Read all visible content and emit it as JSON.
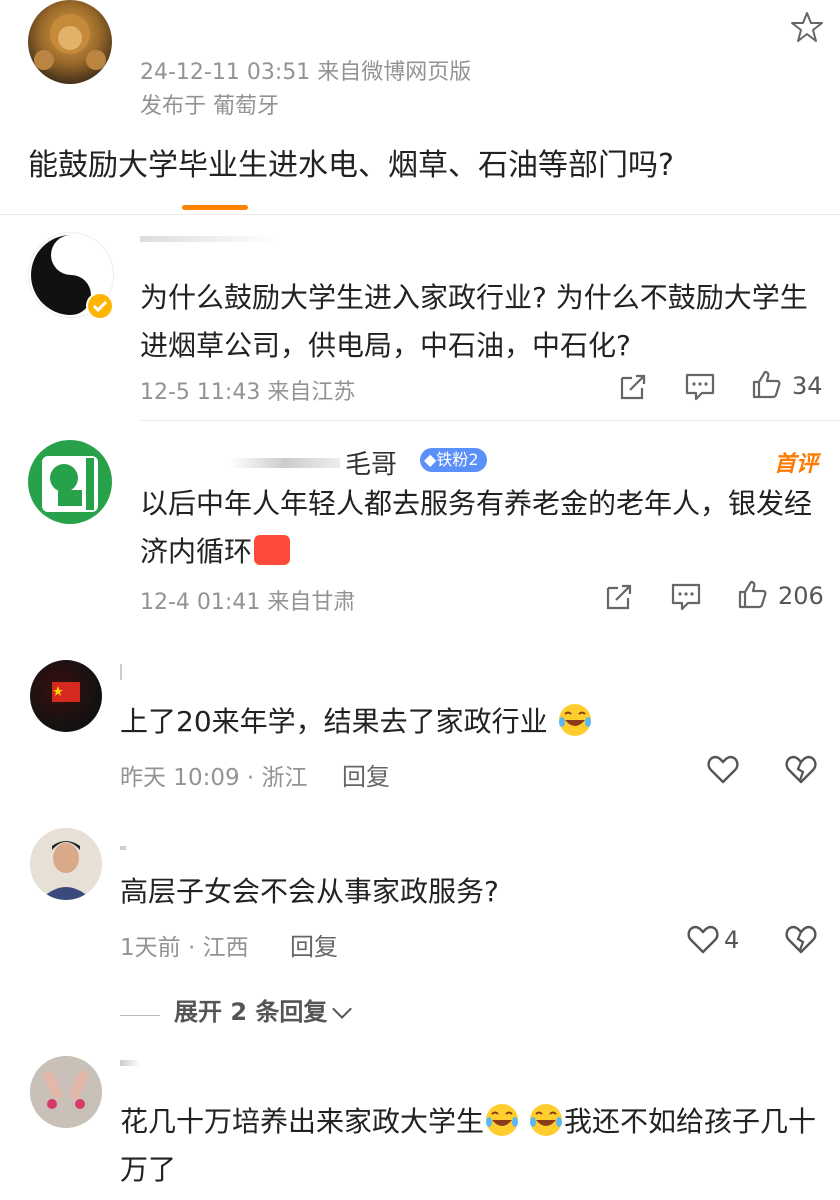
{
  "post": {
    "meta": "24-12-11 03:51  来自微博网页版",
    "location": "发布于  葡萄牙",
    "text": "能鼓励大学毕业生进水电、烟草、石油等部门吗?"
  },
  "comments_weibo": [
    {
      "text": "为什么鼓励大学生进入家政行业?  为什么不鼓励大学生进烟草公司，供电局，中石油，中石化?",
      "meta": "12-5 11:43  来自江苏",
      "likes": "34"
    },
    {
      "name": "毛哥",
      "fan_badge": "铁粉2",
      "tag": "首评",
      "text": "以后中年人年轻人都去服务有养老金的老年人，银发经济内循环",
      "meta": "12-4 01:41  来自甘肃",
      "likes": "206"
    }
  ],
  "comments_app": [
    {
      "text": "上了20来年学，结果去了家政行业",
      "meta": "昨天 10:09 · 浙江",
      "reply": "回复"
    },
    {
      "text": "高层子女会不会从事家政服务?",
      "meta": "1天前 · 江西",
      "reply": "回复",
      "likes": "4",
      "expand": "展开 2 条回复"
    },
    {
      "text": "花几十万培养出来家政大学生",
      "text2": "我还不如给孩子几十万了"
    }
  ]
}
